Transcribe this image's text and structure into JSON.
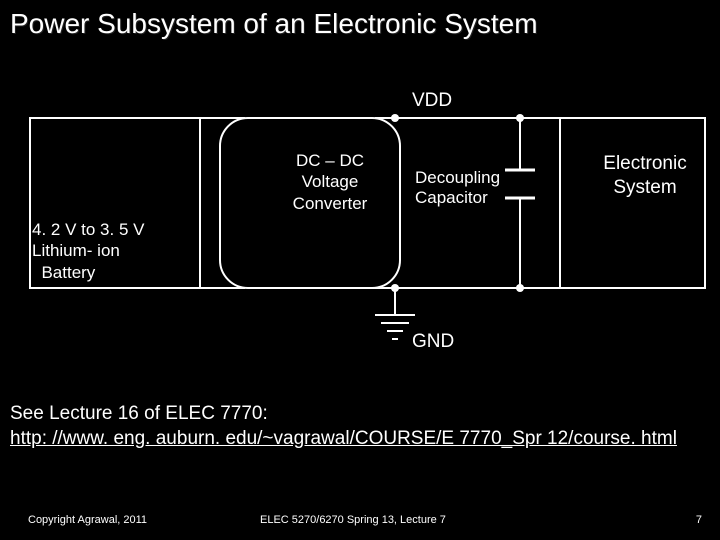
{
  "title": "Power Subsystem of an Electronic System",
  "diagram": {
    "vdd": "VDD",
    "converter_line1": "DC – DC",
    "converter_line2": "Voltage",
    "converter_line3": "Converter",
    "decoupling_line1": "Decoupling",
    "decoupling_line2": "Capacitor",
    "electronic_line1": "Electronic",
    "electronic_line2": "System",
    "battery_line1": "4. 2 V to 3. 5 V",
    "battery_line2": "Lithium- ion",
    "battery_line3": "Battery",
    "gnd": "GND"
  },
  "reference": {
    "line1": "See Lecture 16 of ELEC 7770:",
    "link": "http: //www. eng. auburn. edu/~vagrawal/COURSE/E 7770_Spr 12/course. html"
  },
  "footer": {
    "copyright": "Copyright Agrawal, 2011",
    "course": "ELEC 5270/6270 Spring 13, Lecture 7",
    "page": "7"
  }
}
